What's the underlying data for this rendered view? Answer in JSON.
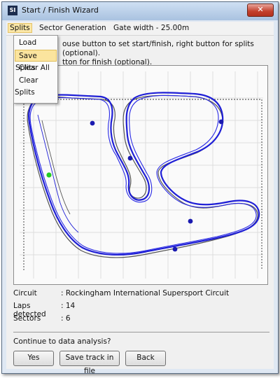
{
  "window": {
    "title": "Start / Finish Wizard",
    "close_glyph": "✕",
    "app_icon_text": "SI"
  },
  "menu": {
    "splits": "Splits",
    "sector_generation": "Sector Generation",
    "gate_width": "Gate width - 25.00m"
  },
  "splits_menu": {
    "items": [
      "Load Splits",
      "Save Splits",
      "Clear All",
      "Clear Splits"
    ],
    "highlighted": "Save Splits"
  },
  "instructions": {
    "line1": "ouse button to set start/finish, right button for splits (optional).",
    "line2": "tton for finish (optional)."
  },
  "map": {
    "track_color": "#1f1fd6",
    "ref_color": "#555555",
    "start_marker_color": "#22cc22",
    "split_marker_color": "#1a1ab0"
  },
  "info": {
    "circuit_label": "Circuit",
    "circuit_value": ": Rockingham International Supersport Circuit",
    "laps_label": "Laps detected",
    "laps_value": ": 14",
    "sectors_label": "Sectors",
    "sectors_value": ": 6"
  },
  "prompt": "Continue to data analysis?",
  "buttons": {
    "yes": "Yes",
    "save_track": "Save track in file",
    "back": "Back"
  }
}
